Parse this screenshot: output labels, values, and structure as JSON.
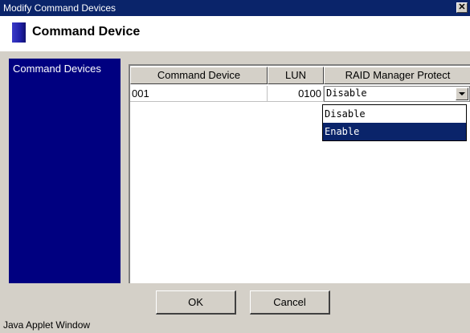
{
  "window": {
    "title": "Modify Command Devices",
    "close_glyph": "✕"
  },
  "header": {
    "title": "Command Device"
  },
  "sidebar": {
    "label": "Command Devices"
  },
  "table": {
    "columns": [
      "Command Device",
      "LUN",
      "RAID Manager Protect"
    ],
    "rows": [
      {
        "command_device": "001",
        "lun": "0100",
        "raid_manager_protect": "Disable"
      }
    ]
  },
  "dropdown": {
    "options": [
      "Disable",
      "Enable"
    ],
    "highlighted": "Enable"
  },
  "buttons": {
    "ok": "OK",
    "cancel": "Cancel"
  },
  "footer": {
    "text": "Java Applet Window"
  },
  "colors": {
    "title_bar": "#0a246a",
    "sidebar": "#000080",
    "selection": "#0a246a",
    "window_bg": "#d4d0c8"
  }
}
